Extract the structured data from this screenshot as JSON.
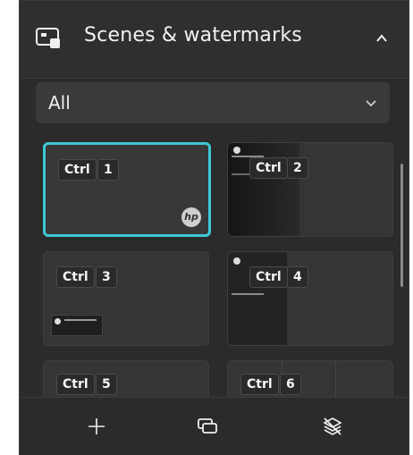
{
  "panel": {
    "title": "Scenes & watermarks",
    "icons": {
      "header": "scene-icon",
      "collapse": "chevron-up-icon"
    }
  },
  "filter": {
    "selected": "All",
    "icon": "chevron-down-icon"
  },
  "scenes": [
    {
      "modifier": "Ctrl",
      "key": "1",
      "selected": true,
      "logo": "hp"
    },
    {
      "modifier": "Ctrl",
      "key": "2",
      "selected": false
    },
    {
      "modifier": "Ctrl",
      "key": "3",
      "selected": false
    },
    {
      "modifier": "Ctrl",
      "key": "4",
      "selected": false
    },
    {
      "modifier": "Ctrl",
      "key": "5",
      "selected": false
    },
    {
      "modifier": "Ctrl",
      "key": "6",
      "selected": false
    }
  ],
  "footer": {
    "icons": [
      "plus-icon",
      "duplicate-icon",
      "layers-off-icon"
    ]
  },
  "colors": {
    "panel_bg": "#2b2b2b",
    "tile_bg": "#353535",
    "selection": "#3ec9d6"
  }
}
